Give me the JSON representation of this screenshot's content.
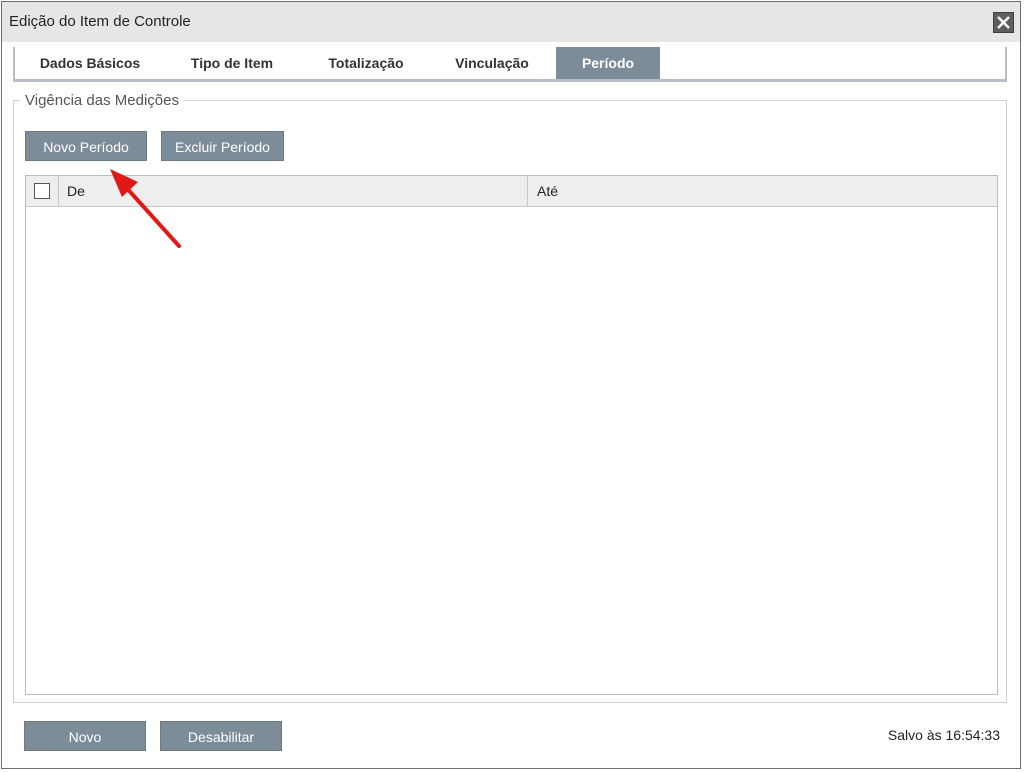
{
  "window": {
    "title": "Edição do Item de Controle",
    "close_icon": "close-icon"
  },
  "tabs": [
    {
      "label": "Dados Básicos",
      "active": false
    },
    {
      "label": "Tipo de Item",
      "active": false
    },
    {
      "label": "Totalização",
      "active": false
    },
    {
      "label": "Vinculação",
      "active": false
    },
    {
      "label": "Período",
      "active": true
    }
  ],
  "section": {
    "legend": "Vigência das Medições",
    "new_button": "Novo Período",
    "delete_button": "Excluir Período"
  },
  "grid": {
    "columns": [
      "De",
      "Até"
    ],
    "rows": []
  },
  "footer": {
    "new_button": "Novo",
    "disable_button": "Desabilitar",
    "status": "Salvo às 16:54:33"
  },
  "colors": {
    "accent": "#7d8c99",
    "annotation_arrow": "#e01818"
  }
}
